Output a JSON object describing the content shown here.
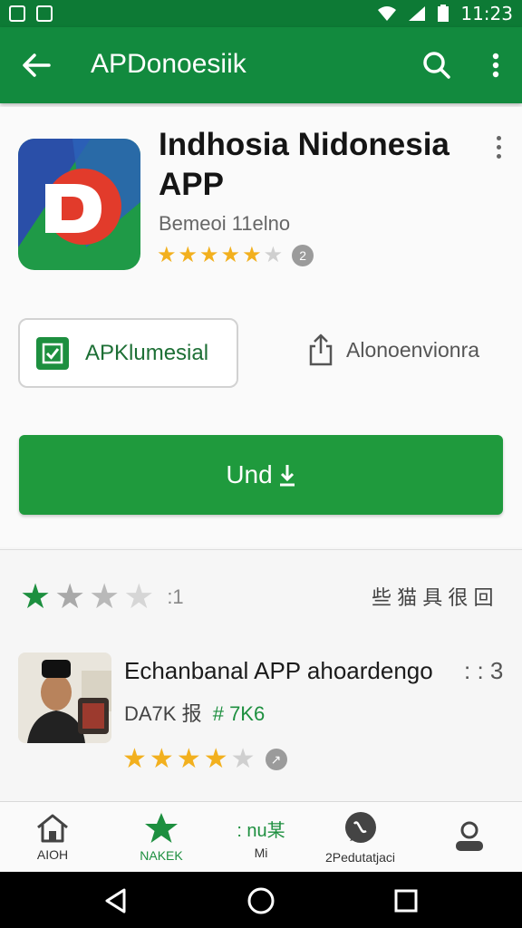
{
  "status_bar": {
    "time": "11:23"
  },
  "app_bar": {
    "title": "APDonoesiik"
  },
  "app": {
    "name": "Indhosia Nidonesia APP",
    "developer": "Bemeoi 11elno",
    "rating_stars": 4.5,
    "rating_badge": "2",
    "verified_label": "APKlumesial",
    "share_label": "Alonoenvionra",
    "install_label": "Und",
    "colors": {
      "primary": "#128a3e",
      "button": "#1f9a3d",
      "star": "#f2b01e"
    }
  },
  "reviews": {
    "stars": 1,
    "count": ":1",
    "side_text": "些 猫 具 很 回"
  },
  "related": {
    "title": "Echanbanal APP ahoardengo",
    "count": ": : 3",
    "sub_left": "DA7K 报",
    "sub_right": "# 7K6",
    "rating_stars": 3.5,
    "rating_badge": "↗"
  },
  "bottom_nav": [
    {
      "label": "AIOH",
      "icon": "home-icon"
    },
    {
      "label": "NAKEK",
      "icon": "star-icon"
    },
    {
      "label": "Mi",
      "icon": "text-icon",
      "icon_text": ": nu某"
    },
    {
      "label": "2Pedutatjaci",
      "icon": "chat-icon"
    },
    {
      "label": "",
      "icon": "person-icon"
    }
  ]
}
